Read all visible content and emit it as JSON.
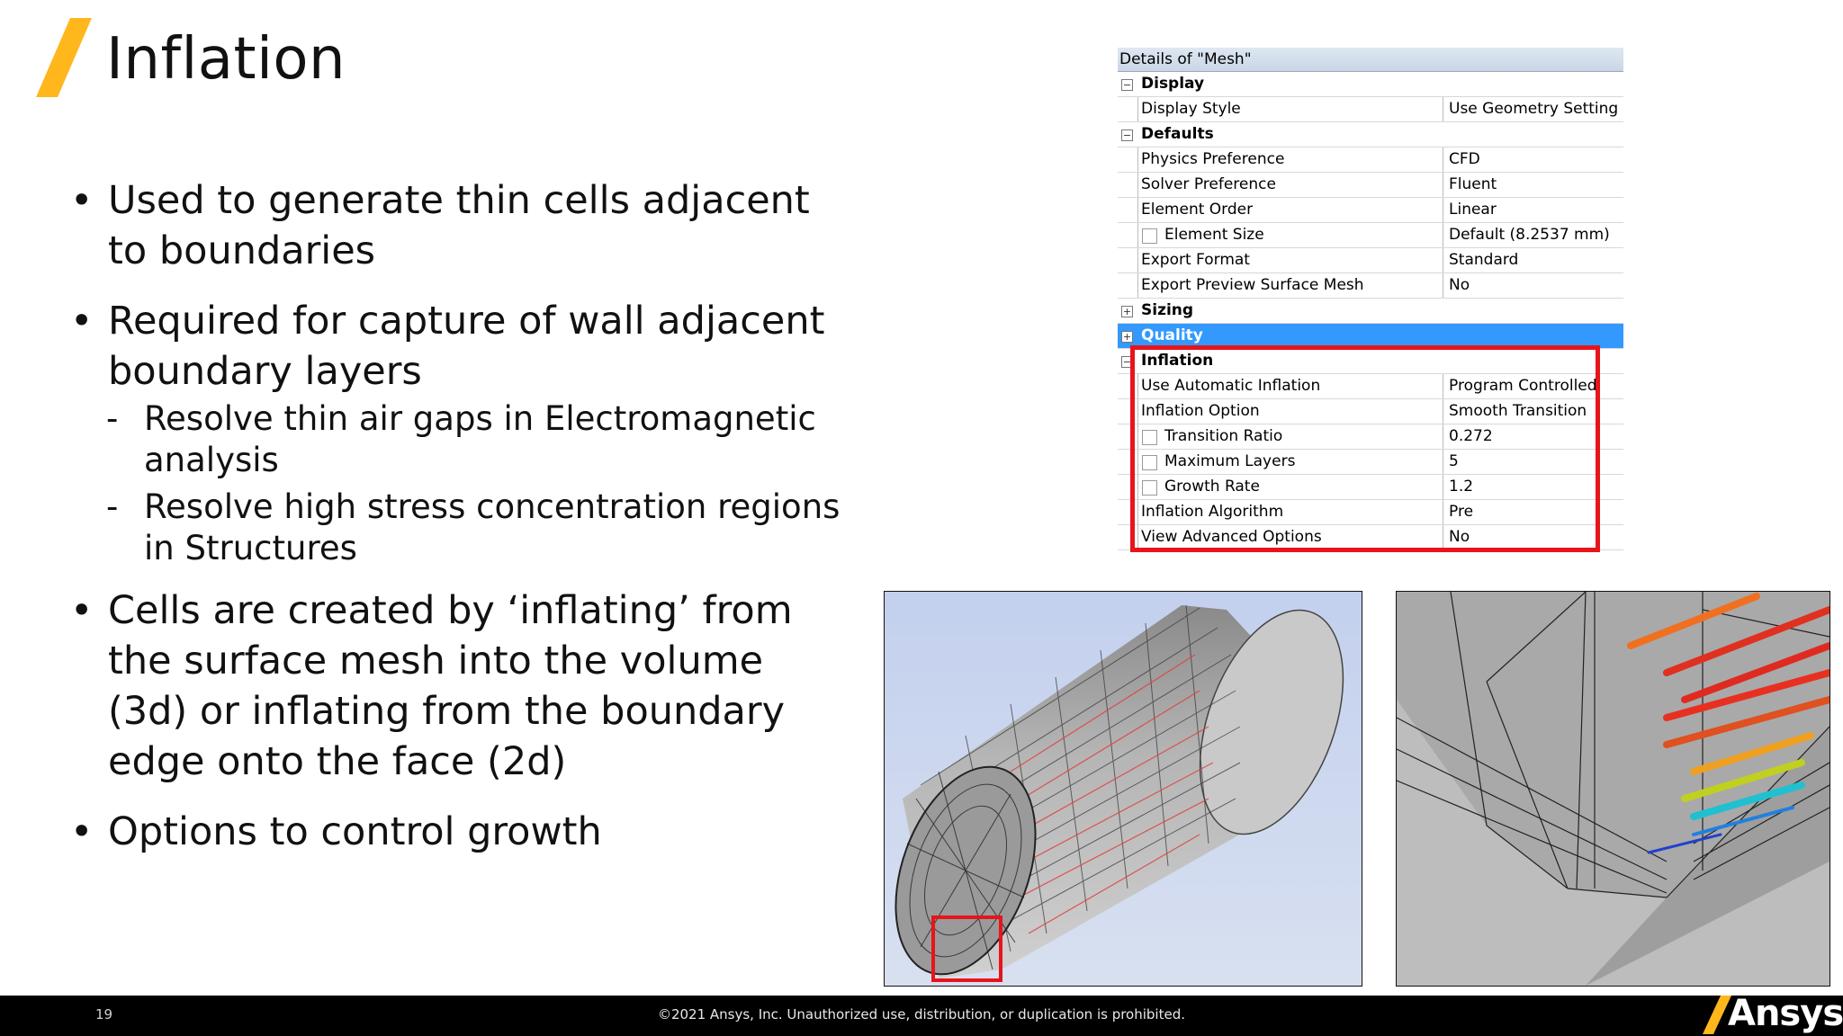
{
  "slide": {
    "title": "Inflation",
    "accent_color": "#ffb71b",
    "bullets": [
      {
        "text": "Used to generate thin cells adjacent to boundaries",
        "subs": []
      },
      {
        "text": "Required for capture of wall adjacent boundary layers",
        "subs": [
          "Resolve thin air gaps in Electromagnetic analysis",
          "Resolve high stress concentration regions in Structures"
        ]
      },
      {
        "text": "Cells are created by ‘inflating’ from the surface mesh into the volume (3d) or inflating from the boundary edge onto the face (2d)",
        "subs": []
      },
      {
        "text": "Options to control growth",
        "subs": []
      }
    ]
  },
  "details_panel": {
    "header": "Details of \"Mesh\"",
    "highlight_color": "#e8141c",
    "selection_color": "#3399ff",
    "rows": [
      {
        "type": "group",
        "expander": "−",
        "label": "Display"
      },
      {
        "type": "prop",
        "label": "Display Style",
        "value": "Use Geometry Setting"
      },
      {
        "type": "group",
        "expander": "−",
        "label": "Defaults"
      },
      {
        "type": "prop",
        "label": "Physics Preference",
        "value": "CFD"
      },
      {
        "type": "prop",
        "label": "Solver Preference",
        "value": "Fluent"
      },
      {
        "type": "prop",
        "label": "Element Order",
        "value": "Linear"
      },
      {
        "type": "check",
        "label": "Element Size",
        "value": "Default (8.2537 mm)"
      },
      {
        "type": "prop",
        "label": "Export Format",
        "value": "Standard"
      },
      {
        "type": "prop",
        "label": "Export Preview Surface Mesh",
        "value": "No"
      },
      {
        "type": "group",
        "expander": "+",
        "label": "Sizing"
      },
      {
        "type": "group",
        "expander": "+",
        "label": "Quality",
        "selected": true
      },
      {
        "type": "group",
        "expander": "−",
        "label": "Inflation"
      },
      {
        "type": "prop",
        "label": "Use Automatic Inflation",
        "value": "Program Controlled"
      },
      {
        "type": "prop",
        "label": "Inflation Option",
        "value": "Smooth Transition"
      },
      {
        "type": "check",
        "label": "Transition Ratio",
        "value": "0.272"
      },
      {
        "type": "check",
        "label": "Maximum Layers",
        "value": "5"
      },
      {
        "type": "check",
        "label": "Growth Rate",
        "value": "1.2"
      },
      {
        "type": "prop",
        "label": "Inflation Algorithm",
        "value": "Pre"
      },
      {
        "type": "prop",
        "label": "View Advanced Options",
        "value": "No"
      }
    ]
  },
  "figures": {
    "mesh_view_bg": "#b8c7e8",
    "closeup_bg": "#b4b4b4"
  },
  "footer": {
    "page_number": "19",
    "copyright": "©2021 Ansys, Inc. Unauthorized use, distribution, or duplication is prohibited.",
    "logo_text": "Ansys",
    "logo_accent": "#ffb71b"
  }
}
